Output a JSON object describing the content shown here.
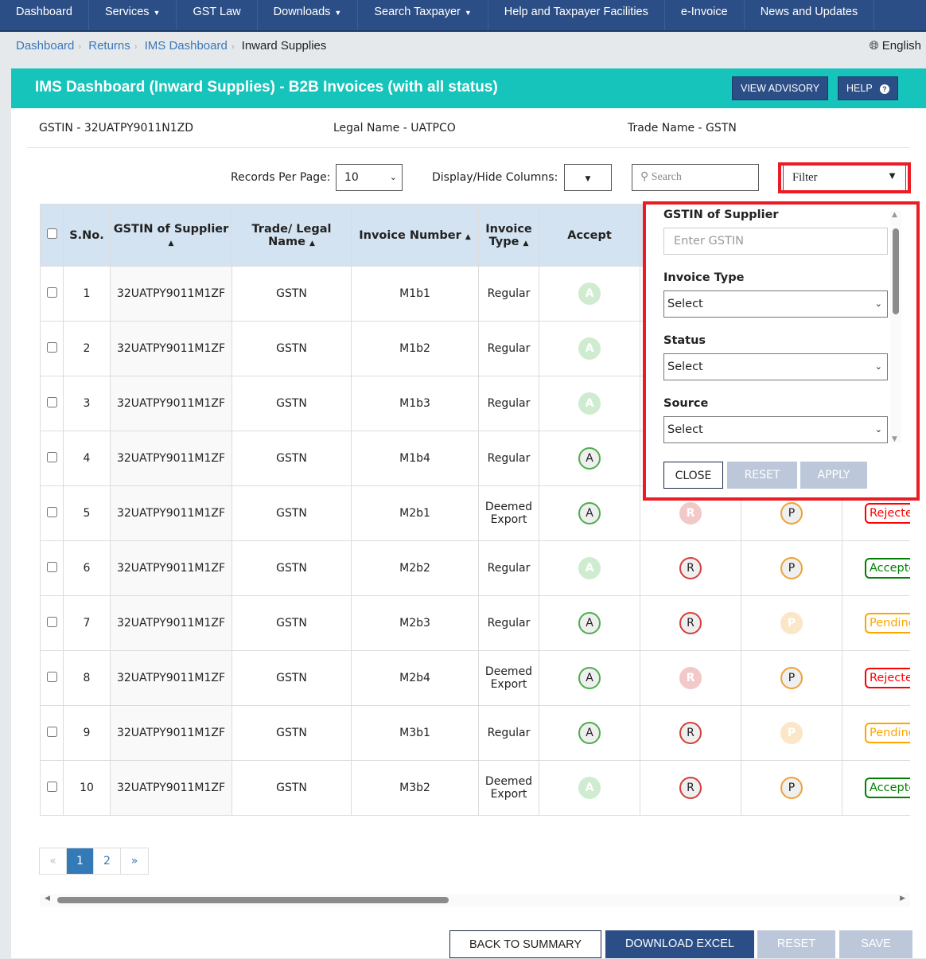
{
  "nav": [
    "Dashboard",
    "Services",
    "GST Law",
    "Downloads",
    "Search Taxpayer",
    "Help and Taxpayer Facilities",
    "e-Invoice",
    "News and Updates"
  ],
  "nav_dropdown": [
    false,
    true,
    false,
    true,
    true,
    false,
    false,
    false
  ],
  "breadcrumb": [
    "Dashboard",
    "Returns",
    "IMS Dashboard",
    "Inward Supplies"
  ],
  "language": "English",
  "banner": {
    "title": "IMS Dashboard (Inward Supplies) - B2B Invoices (with all status)",
    "view_advisory": "VIEW ADVISORY",
    "help": "HELP"
  },
  "info": {
    "gstin": "GSTIN - 32UATPY9011N1ZD",
    "legal": "Legal Name - UATPCO",
    "trade": "Trade Name - GSTN"
  },
  "controls": {
    "records_label": "Records Per Page:",
    "records_value": "10",
    "columns_label": "Display/Hide Columns:",
    "search_placeholder": "Search",
    "filter_label": "Filter"
  },
  "table": {
    "headers": [
      "S.No.",
      "GSTIN of Supplier",
      "Trade/ Legal Name",
      "Invoice Number",
      "Invoice Type",
      "Accept"
    ],
    "rows": [
      {
        "sno": "1",
        "gstin": "32UATPY9011M1ZF",
        "name": "GSTN",
        "inv": "M1b1",
        "type": "Regular",
        "a": "faded"
      },
      {
        "sno": "2",
        "gstin": "32UATPY9011M1ZF",
        "name": "GSTN",
        "inv": "M1b2",
        "type": "Regular",
        "a": "faded"
      },
      {
        "sno": "3",
        "gstin": "32UATPY9011M1ZF",
        "name": "GSTN",
        "inv": "M1b3",
        "type": "Regular",
        "a": "faded"
      },
      {
        "sno": "4",
        "gstin": "32UATPY9011M1ZF",
        "name": "GSTN",
        "inv": "M1b4",
        "type": "Regular",
        "a": "active"
      },
      {
        "sno": "5",
        "gstin": "32UATPY9011M1ZF",
        "name": "GSTN",
        "inv": "M2b1",
        "type": "Deemed Export",
        "a": "active",
        "r": "faded",
        "p": "active",
        "status": "Rejected"
      },
      {
        "sno": "6",
        "gstin": "32UATPY9011M1ZF",
        "name": "GSTN",
        "inv": "M2b2",
        "type": "Regular",
        "a": "faded",
        "r": "active",
        "p": "active",
        "status": "Accepted"
      },
      {
        "sno": "7",
        "gstin": "32UATPY9011M1ZF",
        "name": "GSTN",
        "inv": "M2b3",
        "type": "Regular",
        "a": "active",
        "r": "active",
        "p": "faded",
        "status": "Pending"
      },
      {
        "sno": "8",
        "gstin": "32UATPY9011M1ZF",
        "name": "GSTN",
        "inv": "M2b4",
        "type": "Deemed Export",
        "a": "active",
        "r": "faded",
        "p": "active",
        "status": "Rejected"
      },
      {
        "sno": "9",
        "gstin": "32UATPY9011M1ZF",
        "name": "GSTN",
        "inv": "M3b1",
        "type": "Regular",
        "a": "active",
        "r": "active",
        "p": "faded",
        "status": "Pending"
      },
      {
        "sno": "10",
        "gstin": "32UATPY9011M1ZF",
        "name": "GSTN",
        "inv": "M3b2",
        "type": "Deemed Export",
        "a": "faded",
        "r": "active",
        "p": "active",
        "status": "Accepted"
      }
    ],
    "status_colors": {
      "Rejected": "#ff0000",
      "Accepted": "#008000",
      "Pending": "#ffa500"
    },
    "action_letters": {
      "a": "A",
      "r": "R",
      "p": "P"
    }
  },
  "pagination": {
    "prev": "«",
    "pages": [
      "1",
      "2"
    ],
    "current": "1",
    "next": "»"
  },
  "footer": {
    "back": "BACK TO SUMMARY",
    "download": "DOWNLOAD EXCEL",
    "reset": "RESET",
    "save": "SAVE"
  },
  "filter_panel": {
    "gstin_label": "GSTIN of Supplier",
    "gstin_placeholder": "Enter GSTIN",
    "type_label": "Invoice Type",
    "type_value": "Select",
    "status_label": "Status",
    "status_value": "Select",
    "source_label": "Source",
    "source_value": "Select",
    "close": "CLOSE",
    "reset": "RESET",
    "apply": "APPLY"
  },
  "colors": {
    "nav": "#2c4e86",
    "banner": "#17c4bb",
    "highlight": "#ec1c24"
  }
}
